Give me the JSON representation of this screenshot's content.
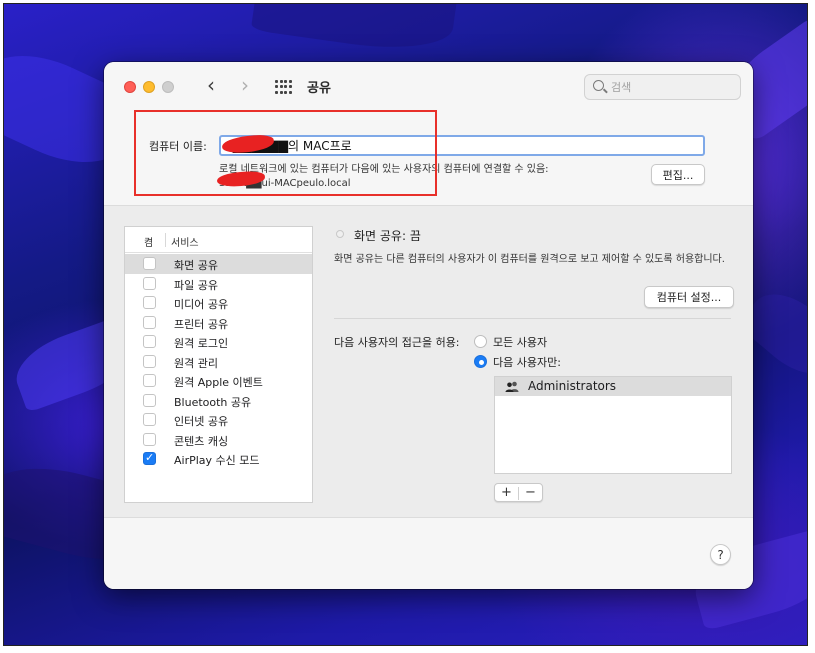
{
  "window": {
    "title": "공유"
  },
  "toolbar": {
    "back_glyph": "‹",
    "forward_glyph": "›",
    "grid_icon": "grid-icon"
  },
  "search": {
    "placeholder": "검색",
    "value": ""
  },
  "computer_name": {
    "label": "컴퓨터 이름:",
    "value": "S▇▇▇▇▇▇의 MAC프로",
    "local_info_line1": "로컬 네트워크에 있는 컴퓨터가 다음에 있는 사용자의 컴퓨터에 연결할 수 있음:",
    "local_info_line2": "SEOK▇▇ui-MACpeulo.local",
    "edit_button": "편집..."
  },
  "services": {
    "header_on": "켬",
    "header_service": "서비스",
    "items": [
      {
        "label": "화면 공유",
        "checked": false,
        "selected": true
      },
      {
        "label": "파일 공유",
        "checked": false,
        "selected": false
      },
      {
        "label": "미디어 공유",
        "checked": false,
        "selected": false
      },
      {
        "label": "프린터 공유",
        "checked": false,
        "selected": false
      },
      {
        "label": "원격 로그인",
        "checked": false,
        "selected": false
      },
      {
        "label": "원격 관리",
        "checked": false,
        "selected": false
      },
      {
        "label": "원격 Apple 이벤트",
        "checked": false,
        "selected": false
      },
      {
        "label": "Bluetooth 공유",
        "checked": false,
        "selected": false
      },
      {
        "label": "인터넷 공유",
        "checked": false,
        "selected": false
      },
      {
        "label": "콘텐츠 캐싱",
        "checked": false,
        "selected": false
      },
      {
        "label": "AirPlay 수신 모드",
        "checked": true,
        "selected": false
      }
    ]
  },
  "detail": {
    "status_title": "화면 공유: 끔",
    "status_desc": "화면 공유는 다른 컴퓨터의 사용자가 이 컴퓨터를 원격으로 보고 제어할 수 있도록 허용합니다.",
    "settings_button": "컴퓨터 설정...",
    "access_label": "다음 사용자의 접근을 허용:",
    "radio_all": "모든 사용자",
    "radio_only": "다음 사용자만:",
    "selected_radio": "only",
    "users": [
      "Administrators"
    ],
    "add_glyph": "+",
    "remove_glyph": "−"
  },
  "help": {
    "glyph": "?"
  },
  "colors": {
    "accent": "#1a7cf5",
    "annotation_red": "#e8302a"
  }
}
